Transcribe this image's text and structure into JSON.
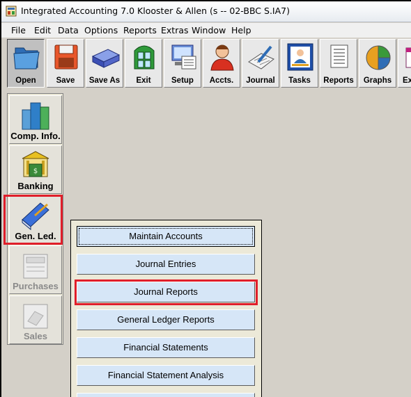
{
  "window": {
    "title": "Integrated Accounting 7.0 Klooster & Allen (s -- 02-BBC S.IA7)"
  },
  "menubar": {
    "items": [
      "File",
      "Edit",
      "Data",
      "Options",
      "Reports",
      "Extras",
      "Window",
      "Help"
    ]
  },
  "toolbar": {
    "buttons": [
      {
        "label": "Open",
        "icon": "folder-icon"
      },
      {
        "label": "Save",
        "icon": "floppy-icon"
      },
      {
        "label": "Save As",
        "icon": "drive-icon"
      },
      {
        "label": "Exit",
        "icon": "door-icon"
      },
      {
        "label": "Setup",
        "icon": "computer-icon"
      },
      {
        "label": "Accts.",
        "icon": "person-icon"
      },
      {
        "label": "Journal",
        "icon": "journal-icon"
      },
      {
        "label": "Tasks",
        "icon": "tasks-icon"
      },
      {
        "label": "Reports",
        "icon": "reports-icon"
      },
      {
        "label": "Graphs",
        "icon": "pie-chart-icon"
      },
      {
        "label": "Ex",
        "icon": "explore-icon"
      }
    ]
  },
  "sidebar": {
    "items": [
      {
        "label": "Comp. Info.",
        "icon": "buildings-icon",
        "enabled": true
      },
      {
        "label": "Banking",
        "icon": "bank-icon",
        "enabled": true
      },
      {
        "label": "Gen. Led.",
        "icon": "ledger-book-icon",
        "enabled": true
      },
      {
        "label": "Purchases",
        "icon": "purchases-icon",
        "enabled": false
      },
      {
        "label": "Sales",
        "icon": "sales-icon",
        "enabled": false
      }
    ]
  },
  "submenu": {
    "items": [
      "Maintain Accounts",
      "Journal Entries",
      "Journal Reports",
      "General Ledger Reports",
      "Financial Statements",
      "Financial Statement Analysis"
    ]
  },
  "colors": {
    "highlight": "#e01e2a",
    "submenu_button": "#d6e6f7"
  }
}
